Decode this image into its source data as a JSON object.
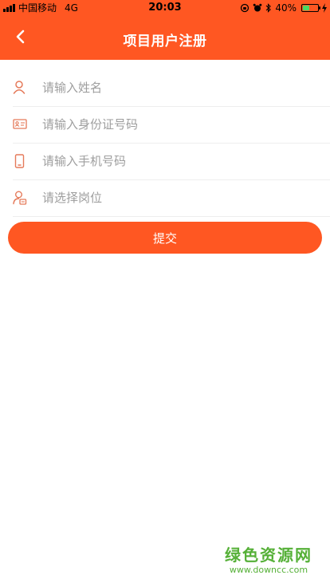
{
  "status_bar": {
    "carrier": "中国移动",
    "network": "4G",
    "time": "20:03",
    "battery": "40%"
  },
  "header": {
    "title": "项目用户注册",
    "back_icon": "chevron-left-icon"
  },
  "form": {
    "name": {
      "placeholder": "请输入姓名",
      "icon": "user-icon"
    },
    "id_card": {
      "placeholder": "请输入身份证号码",
      "icon": "id-card-icon"
    },
    "phone": {
      "placeholder": "请输入手机号码",
      "icon": "mobile-phone-icon"
    },
    "position": {
      "placeholder": "请选择岗位",
      "icon": "user-badge-icon"
    }
  },
  "submit_label": "提交",
  "watermark": {
    "text": "绿色资源网",
    "url": "www.downcc.com"
  },
  "colors": {
    "accent": "#ff5722",
    "icon": "#e57a5a",
    "watermark": "#55b037"
  }
}
